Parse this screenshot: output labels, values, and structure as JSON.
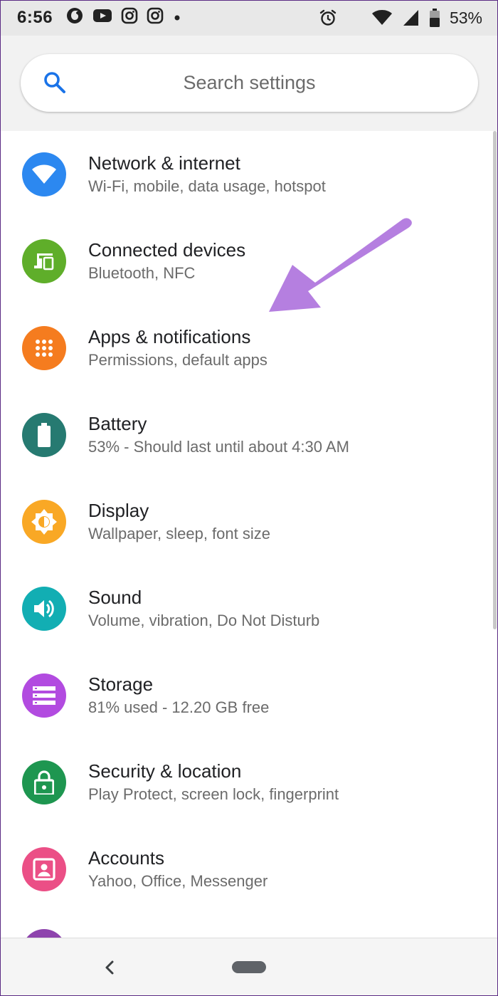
{
  "status_bar": {
    "time": "6:56",
    "battery_percent": "53%",
    "notification_icons": [
      "vodafone-icon",
      "youtube-icon",
      "instagram-icon",
      "instagram-icon",
      "more-dot-icon"
    ],
    "system_icons": [
      "alarm-icon",
      "wifi-icon",
      "signal-icon",
      "battery-icon"
    ]
  },
  "search": {
    "placeholder": "Search settings"
  },
  "settings": [
    {
      "title": "Network & internet",
      "subtitle": "Wi-Fi, mobile, data usage, hotspot",
      "icon": "wifi-icon",
      "color": "#2c88f0"
    },
    {
      "title": "Connected devices",
      "subtitle": "Bluetooth, NFC",
      "icon": "devices-icon",
      "color": "#5fae2a"
    },
    {
      "title": "Apps & notifications",
      "subtitle": "Permissions, default apps",
      "icon": "apps-grid-icon",
      "color": "#f57c1f"
    },
    {
      "title": "Battery",
      "subtitle": "53% - Should last until about 4:30 AM",
      "icon": "battery-icon",
      "color": "#267a71"
    },
    {
      "title": "Display",
      "subtitle": "Wallpaper, sleep, font size",
      "icon": "brightness-icon",
      "color": "#f9a825"
    },
    {
      "title": "Sound",
      "subtitle": "Volume, vibration, Do Not Disturb",
      "icon": "volume-icon",
      "color": "#12aeb3"
    },
    {
      "title": "Storage",
      "subtitle": "81% used - 12.20 GB free",
      "icon": "storage-icon",
      "color": "#b24be0"
    },
    {
      "title": "Security & location",
      "subtitle": "Play Protect, screen lock, fingerprint",
      "icon": "lock-icon",
      "color": "#1e9650"
    },
    {
      "title": "Accounts",
      "subtitle": "Yahoo, Office, Messenger",
      "icon": "account-icon",
      "color": "#eb4f86"
    }
  ],
  "colors": {
    "annotation_arrow": "#b57fe0",
    "partial_item_icon": "#8e44ad"
  }
}
